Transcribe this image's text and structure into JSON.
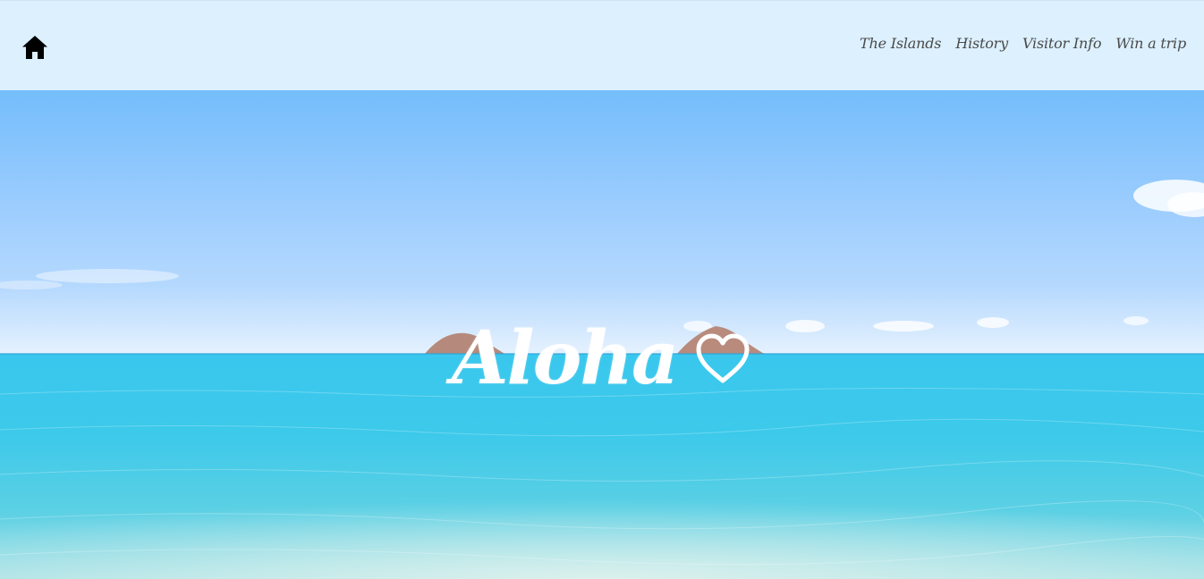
{
  "nav": {
    "items": [
      {
        "label": "The Islands"
      },
      {
        "label": "History"
      },
      {
        "label": "Visitor Info"
      },
      {
        "label": "Win a trip"
      }
    ]
  },
  "hero": {
    "title": "Aloha",
    "heart_icon": "heart-outline",
    "image": "ocean-and-islands"
  },
  "colors": {
    "topbar_bg": "#dcf0fe",
    "nav_text": "#4a4a4a",
    "sky_top": "#74bdfc",
    "sea": "#34c6ea",
    "title": "#ffffff"
  },
  "icons": {
    "home": "home-icon"
  }
}
